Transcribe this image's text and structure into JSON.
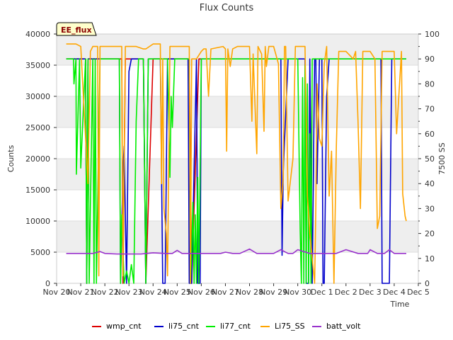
{
  "chart_data": {
    "type": "line",
    "title": "Flux Counts",
    "badge": "EE_flux",
    "xlabel": "Time",
    "ylabel": "Counts",
    "y2label": "7500 SS",
    "x_ticks": [
      "Nov 20",
      "Nov 21",
      "Nov 22",
      "Nov 23",
      "Nov 24",
      "Nov 25",
      "Nov 26",
      "Nov 27",
      "Nov 28",
      "Nov 29",
      "Nov 30",
      "Dec 1",
      "Dec 2",
      "Dec 3",
      "Dec 4",
      "Dec 5"
    ],
    "xlim": [
      0,
      15
    ],
    "y_ticks": [
      "0",
      "5000",
      "10000",
      "15000",
      "20000",
      "25000",
      "30000",
      "35000",
      "40000"
    ],
    "ylim": [
      0,
      40000
    ],
    "y2_ticks": [
      "0",
      "10",
      "20",
      "30",
      "40",
      "50",
      "60",
      "70",
      "80",
      "90",
      "100"
    ],
    "y2lim": [
      0,
      100
    ],
    "grid": true,
    "legend_position": "bottom",
    "series": [
      {
        "name": "wmp_cnt",
        "color": "#dd0000",
        "axis": "left",
        "x": [
          0.4,
          1.2,
          1.25,
          1.3,
          1.8,
          2.7,
          2.75,
          2.85,
          3.3,
          3.6,
          3.7,
          4.0,
          4.4,
          4.6,
          5.0,
          5.5,
          5.6,
          5.9,
          6.0
        ],
        "y": [
          36000,
          36000,
          0,
          36000,
          36000,
          36000,
          0,
          36000,
          36000,
          36000,
          0,
          36000,
          36000,
          36000,
          36000,
          36000,
          0,
          36000,
          36000
        ]
      },
      {
        "name": "li75_cnt",
        "color": "#0000cc",
        "axis": "left",
        "x": [
          0.4,
          1.2,
          1.25,
          1.3,
          1.7,
          2.6,
          2.65,
          2.75,
          2.8,
          2.9,
          3.0,
          3.1,
          3.2,
          3.6,
          3.7,
          3.8,
          4.3,
          4.4,
          4.5,
          4.6,
          5.0,
          5.45,
          5.5,
          5.6,
          5.8,
          5.85,
          5.95,
          6.0,
          9.0,
          9.3,
          9.35,
          9.4,
          9.6,
          10.0,
          10.3,
          10.35,
          10.45,
          10.5,
          10.6,
          10.7,
          10.75,
          10.8,
          10.9,
          11.0,
          11.05,
          11.1,
          11.2,
          11.3,
          11.35,
          12.0,
          13.0,
          13.45,
          13.5,
          13.8,
          13.9,
          14.0,
          14.5
        ],
        "y": [
          36000,
          36000,
          0,
          36000,
          36000,
          36000,
          0,
          18000,
          22000,
          0,
          34000,
          36000,
          36000,
          36000,
          0,
          36000,
          36000,
          0,
          0,
          36000,
          36000,
          36000,
          0,
          0,
          36000,
          0,
          0,
          36000,
          36000,
          36000,
          4500,
          18000,
          36000,
          36000,
          36000,
          0,
          0,
          36000,
          0,
          36000,
          36000,
          16000,
          36000,
          36000,
          0,
          0,
          30000,
          36000,
          36000,
          36000,
          36000,
          36000,
          0,
          0,
          36000,
          36000,
          36000
        ]
      },
      {
        "name": "li77_cnt",
        "color": "#00ee00",
        "axis": "left",
        "x": [
          0.4,
          0.7,
          0.72,
          0.8,
          0.82,
          0.95,
          1.0,
          1.2,
          1.25,
          1.3,
          1.35,
          1.5,
          1.55,
          1.6,
          1.65,
          1.8,
          2.6,
          2.65,
          2.7,
          2.8,
          2.9,
          3.0,
          3.1,
          3.2,
          3.3,
          3.4,
          3.5,
          3.6,
          3.7,
          3.8,
          4.0,
          4.6,
          4.7,
          4.75,
          4.8,
          4.9,
          5.0,
          5.5,
          5.55,
          5.6,
          5.65,
          5.7,
          5.75,
          5.8,
          5.85,
          5.9,
          6.0,
          10.0,
          10.1,
          10.15,
          10.2,
          10.25,
          10.3,
          10.35,
          10.4,
          10.45,
          10.5,
          10.55,
          10.6,
          10.7,
          11.0,
          14.5
        ],
        "y": [
          36000,
          36000,
          32000,
          36000,
          17500,
          36000,
          18500,
          36000,
          0,
          36000,
          0,
          36000,
          0,
          36000,
          0,
          36000,
          36000,
          0,
          11000,
          0,
          2000,
          0,
          3000,
          0,
          26000,
          36000,
          36000,
          36000,
          0,
          36000,
          36000,
          36000,
          17000,
          30000,
          25000,
          36000,
          36000,
          36000,
          0,
          5000,
          13000,
          0,
          11000,
          0,
          17000,
          0,
          36000,
          36000,
          8500,
          0,
          33000,
          0,
          35000,
          0,
          32000,
          0,
          24000,
          0,
          36000,
          36000,
          36000,
          36000
        ]
      },
      {
        "name": "Li75_SS",
        "color": "#ffa500",
        "axis": "right",
        "x": [
          0.4,
          0.8,
          1.0,
          1.3,
          1.4,
          1.5,
          1.7,
          1.75,
          1.8,
          2.7,
          2.75,
          2.85,
          3.3,
          3.6,
          3.7,
          4.0,
          4.3,
          4.35,
          4.4,
          4.45,
          4.5,
          4.55,
          4.6,
          4.7,
          5.0,
          5.5,
          5.55,
          5.6,
          5.8,
          6.0,
          6.1,
          6.2,
          6.3,
          6.4,
          6.9,
          7.0,
          7.05,
          7.1,
          7.2,
          7.3,
          7.5,
          8.0,
          8.1,
          8.15,
          8.3,
          8.35,
          8.5,
          8.6,
          8.65,
          8.7,
          8.8,
          9.0,
          9.2,
          9.3,
          9.4,
          9.45,
          9.5,
          9.6,
          9.8,
          9.9,
          10.0,
          10.3,
          10.4,
          10.5,
          10.6,
          10.7,
          10.75,
          10.8,
          10.9,
          11.0,
          11.1,
          11.2,
          11.3,
          11.4,
          11.5,
          11.6,
          11.7,
          12.0,
          12.3,
          12.4,
          12.5,
          12.6,
          12.7,
          12.8,
          13.0,
          13.2,
          13.3,
          13.4,
          13.5,
          13.8,
          13.9,
          14.0,
          14.1,
          14.3,
          14.35,
          14.45,
          14.5
        ],
        "y": [
          96,
          96,
          95,
          40,
          93,
          95,
          95,
          3,
          95,
          95,
          3,
          95,
          95,
          94,
          94,
          96,
          96,
          40,
          90,
          30,
          25,
          20,
          3,
          95,
          95,
          95,
          0,
          90,
          90,
          93,
          94,
          94,
          75,
          94,
          95,
          94,
          53,
          94,
          87,
          94,
          95,
          95,
          65,
          92,
          52,
          95,
          92,
          61,
          95,
          87,
          95,
          95,
          88,
          30,
          42,
          95,
          95,
          33,
          50,
          95,
          95,
          95,
          35,
          20,
          10,
          0,
          30,
          80,
          58,
          55,
          88,
          95,
          35,
          53,
          0,
          55,
          93,
          93,
          90,
          93,
          65,
          30,
          93,
          93,
          93,
          90,
          22,
          27,
          93,
          93,
          93,
          93,
          60,
          93,
          36,
          27,
          25
        ]
      },
      {
        "name": "batt_volt",
        "color": "#9933cc",
        "axis": "left",
        "x": [
          0.4,
          1.5,
          1.8,
          2.0,
          2.5,
          3.0,
          3.5,
          4.0,
          4.5,
          4.8,
          5.0,
          5.2,
          5.5,
          6.0,
          6.5,
          6.8,
          7.0,
          7.3,
          7.6,
          8.0,
          8.3,
          8.6,
          9.0,
          9.3,
          9.6,
          9.8,
          10.0,
          10.5,
          11.0,
          11.3,
          11.6,
          12.0,
          12.5,
          12.9,
          13.0,
          13.3,
          13.6,
          13.8,
          14.0,
          14.5
        ],
        "y": [
          4800,
          4800,
          5100,
          4800,
          4700,
          4700,
          4700,
          4900,
          4800,
          4800,
          5300,
          4800,
          4800,
          4800,
          4800,
          4800,
          5000,
          4800,
          4800,
          5500,
          4800,
          4800,
          4800,
          5400,
          4800,
          4800,
          5400,
          4800,
          4800,
          4800,
          4800,
          5400,
          4800,
          4800,
          5400,
          4800,
          4800,
          5400,
          4800,
          4800
        ]
      }
    ]
  }
}
